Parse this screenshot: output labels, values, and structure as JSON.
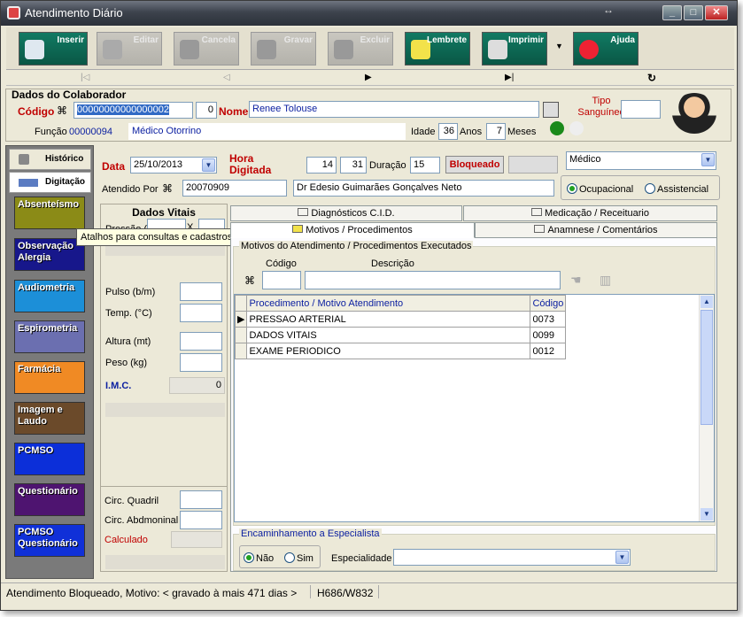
{
  "window": {
    "title": "Atendimento Diário",
    "min": "_",
    "max": "□",
    "close": "✕",
    "resize_glyph": "↔"
  },
  "toolbar": {
    "buttons": [
      {
        "label": "Inserir",
        "enabled": true
      },
      {
        "label": "Editar",
        "enabled": false
      },
      {
        "label": "Cancela",
        "enabled": false
      },
      {
        "label": "Gravar",
        "enabled": false
      },
      {
        "label": "Excluir",
        "enabled": false
      },
      {
        "label": "Lembrete",
        "enabled": true
      },
      {
        "label": "Imprimir",
        "enabled": true
      },
      {
        "label": "Ajuda",
        "enabled": true
      }
    ],
    "print_dropdown": "▼"
  },
  "nav": {
    "first": "|◁",
    "prior": "◁",
    "next": "▶",
    "last": "▶|",
    "refresh": "↻"
  },
  "colaborador": {
    "section_title": "Dados do Colaborador",
    "codigo_label": "Código",
    "codigo_value": "00000000000000002",
    "codigo_small": "0",
    "nome_label": "Nome",
    "nome_value": "Renee Tolouse",
    "tipo_sanguineo_label": "Tipo Sanguíneo",
    "tipo_sanguineo_value": "",
    "funcao_label": "Função",
    "funcao_code": "00000094",
    "funcao_desc": "Médico Otorrino",
    "idade_label": "Idade",
    "idade_value": "36",
    "anos_label": "Anos",
    "meses_value": "7",
    "meses_label": "Meses",
    "status_colors": [
      "#1a8a1a",
      "#e8e8e8"
    ]
  },
  "sidebar": {
    "historico": "Histórico",
    "digitacao": "Digitação",
    "tooltip": "Atalhos para consultas e cadastros",
    "items": [
      {
        "label": "Absenteísmo",
        "color": "#8b8b17"
      },
      {
        "label": "Observação Alergia",
        "color": "#17178b"
      },
      {
        "label": "Audiometria",
        "color": "#1c8fd8"
      },
      {
        "label": "Espirometria",
        "color": "#6b6fb0"
      },
      {
        "label": "Farmácia",
        "color": "#f08a24"
      },
      {
        "label": "Imagem e Laudo",
        "color": "#6b4a2a"
      },
      {
        "label": "PCMSO",
        "color": "#0c2fd9"
      },
      {
        "label": "Questionário",
        "color": "#4e1470"
      },
      {
        "label": "PCMSO Questionário",
        "color": "#1030d8"
      }
    ]
  },
  "atendimento": {
    "data_label": "Data",
    "data_value": "25/10/2013",
    "hora_label": "Hora Digitada",
    "hora_h": "14",
    "hora_m": "31",
    "duracao_label": "Duração",
    "duracao_value": "15",
    "bloqueado_label": "Bloqueado",
    "atendido_label": "Atendido Por",
    "atendido_code": "20070909",
    "atendido_nome": "Dr Edesio Guimarães Gonçalves Neto",
    "tipo_select": "Médico",
    "ocupacional": "Ocupacional",
    "assistencial": "Assistencial"
  },
  "vitais": {
    "title": "Dados Vitais",
    "pressao": "Pressão (mmHg)",
    "x": "X",
    "pulso": "Pulso (b/m)",
    "temp": "Temp. (°C)",
    "altura": "Altura (mt)",
    "peso": "Peso (kg)",
    "imc_label": "I.M.C.",
    "imc_value": "0",
    "quadril": "Circ. Quadril",
    "abdominal": "Circ. Abdmoninal",
    "calculado": "Calculado"
  },
  "tabs": {
    "row1": [
      "Diagnósticos C.I.D.",
      "Medicação / Receituario"
    ],
    "row2": [
      "Motivos / Procedimentos",
      "Anamnese / Comentários"
    ]
  },
  "motivos": {
    "group_title": "Motivos do Atendimento / Procedimentos Executados",
    "codigo_label": "Código",
    "descricao_label": "Descrição",
    "grid_headers": [
      "Procedimento / Motivo Atendimento",
      "Código"
    ],
    "rows": [
      {
        "desc": "PRESSAO ARTERIAL",
        "code": "0073"
      },
      {
        "desc": "DADOS VITAIS",
        "code": "0099"
      },
      {
        "desc": "EXAME PERIODICO",
        "code": "0012"
      }
    ]
  },
  "encaminhamento": {
    "title": "Encaminhamento a Especialista",
    "nao": "Não",
    "sim": "Sim",
    "especialidade_label": "Especialidade",
    "especialidade_value": ""
  },
  "statusbar": {
    "message": "Atendimento Bloqueado, Motivo: < gravado à mais 471 dias >",
    "dims": "H686/W832"
  }
}
